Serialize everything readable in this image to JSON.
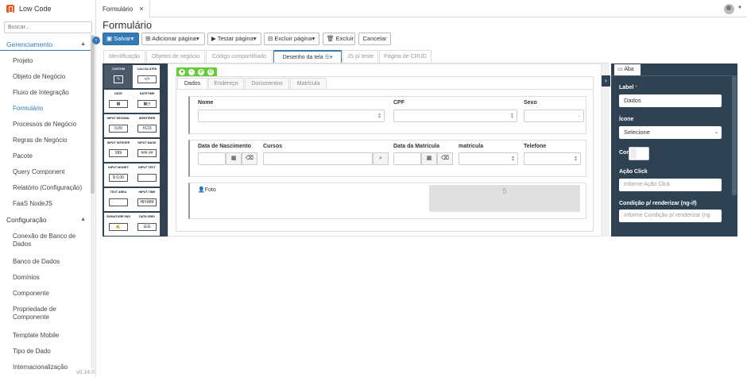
{
  "app": {
    "title": "Low Code",
    "version": "v0.14.0"
  },
  "sidebar": {
    "search_placeholder": "Buscar...",
    "sections": [
      {
        "label": "Gerenciamento",
        "items": [
          "Projeto",
          "Objeto de Negócio",
          "Fluxo de Integração",
          "Formulário",
          "Processos de Negócio",
          "Regras de Negócio",
          "Pacote",
          "Query Component",
          "Relatório (Configuração)",
          "FaaS NodeJS"
        ]
      },
      {
        "label": "Configuração",
        "items": [
          "Conexão de Banco de Dados",
          "Banco de Dados",
          "Domínios",
          "Componente",
          "Propriedade de Componente",
          "Template Mobile",
          "Tipo de Dado",
          "Internacionalização"
        ]
      }
    ],
    "active_item": "Formulário"
  },
  "topbar": {
    "tab_label": "Formulário",
    "close_glyph": "×"
  },
  "page": {
    "title": "Formulário"
  },
  "toolbar": {
    "save": "Salvar",
    "add_page": "Adicionar página",
    "test_page": "Testar página",
    "delete_page": "Excluir página",
    "delete": "Excluir",
    "cancel": "Cancelar"
  },
  "page_tabs": [
    "Identificação",
    "Objetos de negócio",
    "Código compartilhado",
    "Desenho da tela",
    "JS p/ teste",
    "Página de CRUD"
  ],
  "palette": {
    "header": [
      "CUSTOM",
      "CALCULATED"
    ],
    "items": [
      {
        "label": "DATE",
        "icon": "▦"
      },
      {
        "label": "DATETIME",
        "icon": "▦◷"
      },
      {
        "label": "INPUT DECIMAL",
        "icon": "0,00"
      },
      {
        "label": "IDENTIFIER",
        "icon": "#123"
      },
      {
        "label": "INPUT INTEGER",
        "icon": "999"
      },
      {
        "label": "INPUT MASK",
        "icon": "###.##"
      },
      {
        "label": "INPUT MONEY",
        "icon": "$ 0,00"
      },
      {
        "label": "INPUT TEXT",
        "icon": ""
      },
      {
        "label": "TEXT AREA",
        "icon": ""
      },
      {
        "label": "INPUT TIME",
        "icon": "HH:MM"
      },
      {
        "label": "SIGNATURE PAD",
        "icon": "✍"
      },
      {
        "label": "DATA GRID",
        "icon": "☰☰"
      }
    ]
  },
  "form": {
    "tabs": [
      "Dados",
      "Endereço",
      "Documentos",
      "Matrícula"
    ],
    "row1": {
      "nome": "Nome",
      "cpf": "CPF",
      "sexo": "Sexo"
    },
    "row2": {
      "nascimento": "Data de Nascimento",
      "cursos": "Cursos",
      "matricula_data": "Data da Matrícula",
      "matricula": "matricula",
      "telefone": "Telefone"
    },
    "row3": {
      "foto": "Foto",
      "foto_placeholder": "5"
    }
  },
  "props": {
    "tab": "Aba",
    "label_label": "Label",
    "label_value": "Dados",
    "icon_label": "Ícone",
    "icon_value": "Selecione",
    "color_label": "Cor",
    "action_label": "Ação Click",
    "action_placeholder": "Informe Ação Click",
    "cond_label": "Condição p/ renderizar (ng-if)",
    "cond_placeholder": "Informe Condição p/ renderizar (ng"
  },
  "colors": {
    "accent": "#337ab7",
    "panel": "#2f4254",
    "grid_tools": "#66cc33"
  }
}
